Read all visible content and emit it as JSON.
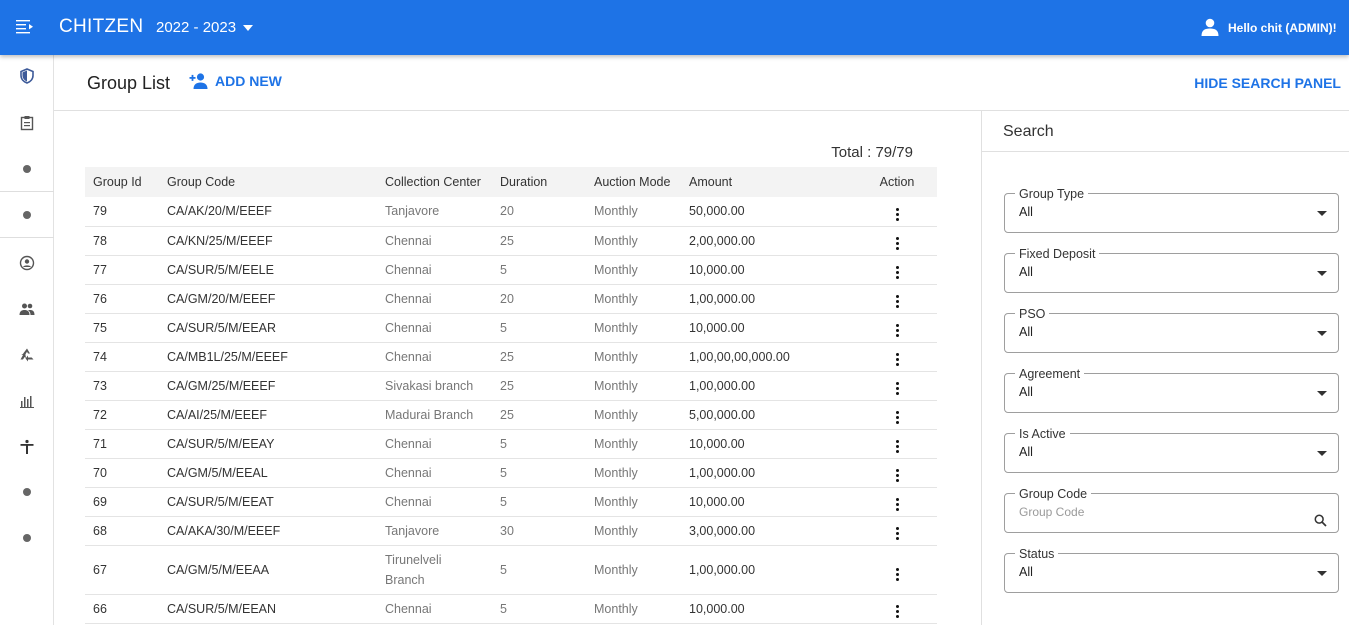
{
  "header": {
    "brand": "CHITZEN",
    "year": "2022 - 2023",
    "user": "Hello chit (ADMIN)!"
  },
  "sidebar": {
    "items": [
      {
        "icon": "shield-icon"
      },
      {
        "icon": "clipboard-icon"
      },
      {
        "icon": "dot-icon"
      },
      {
        "icon": "dot-icon"
      },
      {
        "icon": "account-circle-icon"
      },
      {
        "icon": "people-icon"
      },
      {
        "icon": "recycle-icon"
      },
      {
        "icon": "bar-chart-icon"
      },
      {
        "icon": "accessibility-icon"
      },
      {
        "icon": "dot-icon"
      },
      {
        "icon": "dot-icon"
      }
    ]
  },
  "page": {
    "title": "Group List",
    "add_new": "ADD NEW",
    "hide_search": "HIDE SEARCH PANEL",
    "total": "Total : 79/79"
  },
  "table": {
    "columns": [
      "Group Id",
      "Group Code",
      "Collection Center",
      "Duration",
      "Auction Mode",
      "Amount",
      "Action"
    ],
    "rows": [
      {
        "id": "79",
        "code": "CA/AK/20/M/EEEF",
        "center": "Tanjavore",
        "duration": "20",
        "mode": "Monthly",
        "amount": "50,000.00"
      },
      {
        "id": "78",
        "code": "CA/KN/25/M/EEEF",
        "center": "Chennai",
        "duration": "25",
        "mode": "Monthly",
        "amount": "2,00,000.00"
      },
      {
        "id": "77",
        "code": "CA/SUR/5/M/EELE",
        "center": "Chennai",
        "duration": "5",
        "mode": "Monthly",
        "amount": "10,000.00"
      },
      {
        "id": "76",
        "code": "CA/GM/20/M/EEEF",
        "center": "Chennai",
        "duration": "20",
        "mode": "Monthly",
        "amount": "1,00,000.00"
      },
      {
        "id": "75",
        "code": "CA/SUR/5/M/EEAR",
        "center": "Chennai",
        "duration": "5",
        "mode": "Monthly",
        "amount": "10,000.00"
      },
      {
        "id": "74",
        "code": "CA/MB1L/25/M/EEEF",
        "center": "Chennai",
        "duration": "25",
        "mode": "Monthly",
        "amount": "1,00,00,00,000.00"
      },
      {
        "id": "73",
        "code": "CA/GM/25/M/EEEF",
        "center": "Sivakasi branch",
        "duration": "25",
        "mode": "Monthly",
        "amount": "1,00,000.00"
      },
      {
        "id": "72",
        "code": "CA/AI/25/M/EEEF",
        "center": "Madurai Branch",
        "duration": "25",
        "mode": "Monthly",
        "amount": "5,00,000.00"
      },
      {
        "id": "71",
        "code": "CA/SUR/5/M/EEAY",
        "center": "Chennai",
        "duration": "5",
        "mode": "Monthly",
        "amount": "10,000.00"
      },
      {
        "id": "70",
        "code": "CA/GM/5/M/EEAL",
        "center": "Chennai",
        "duration": "5",
        "mode": "Monthly",
        "amount": "1,00,000.00"
      },
      {
        "id": "69",
        "code": "CA/SUR/5/M/EEAT",
        "center": "Chennai",
        "duration": "5",
        "mode": "Monthly",
        "amount": "10,000.00"
      },
      {
        "id": "68",
        "code": "CA/AKA/30/M/EEEF",
        "center": "Tanjavore",
        "duration": "30",
        "mode": "Monthly",
        "amount": "3,00,000.00"
      },
      {
        "id": "67",
        "code": "CA/GM/5/M/EEAA",
        "center": "Tirunelveli Branch",
        "duration": "5",
        "mode": "Monthly",
        "amount": "1,00,000.00"
      },
      {
        "id": "66",
        "code": "CA/SUR/5/M/EEAN",
        "center": "Chennai",
        "duration": "5",
        "mode": "Monthly",
        "amount": "10,000.00"
      }
    ]
  },
  "search": {
    "title": "Search",
    "fields": [
      {
        "label": "Group Type",
        "value": "All",
        "kind": "select"
      },
      {
        "label": "Fixed Deposit",
        "value": "All",
        "kind": "select"
      },
      {
        "label": "PSO",
        "value": "All",
        "kind": "select"
      },
      {
        "label": "Agreement",
        "value": "All",
        "kind": "select"
      },
      {
        "label": "Is Active",
        "value": "All",
        "kind": "select"
      },
      {
        "label": "Group Code",
        "value": "",
        "placeholder": "Group Code",
        "kind": "text"
      },
      {
        "label": "Status",
        "value": "All",
        "kind": "select"
      }
    ]
  },
  "colors": {
    "primary": "#1e73e6"
  }
}
